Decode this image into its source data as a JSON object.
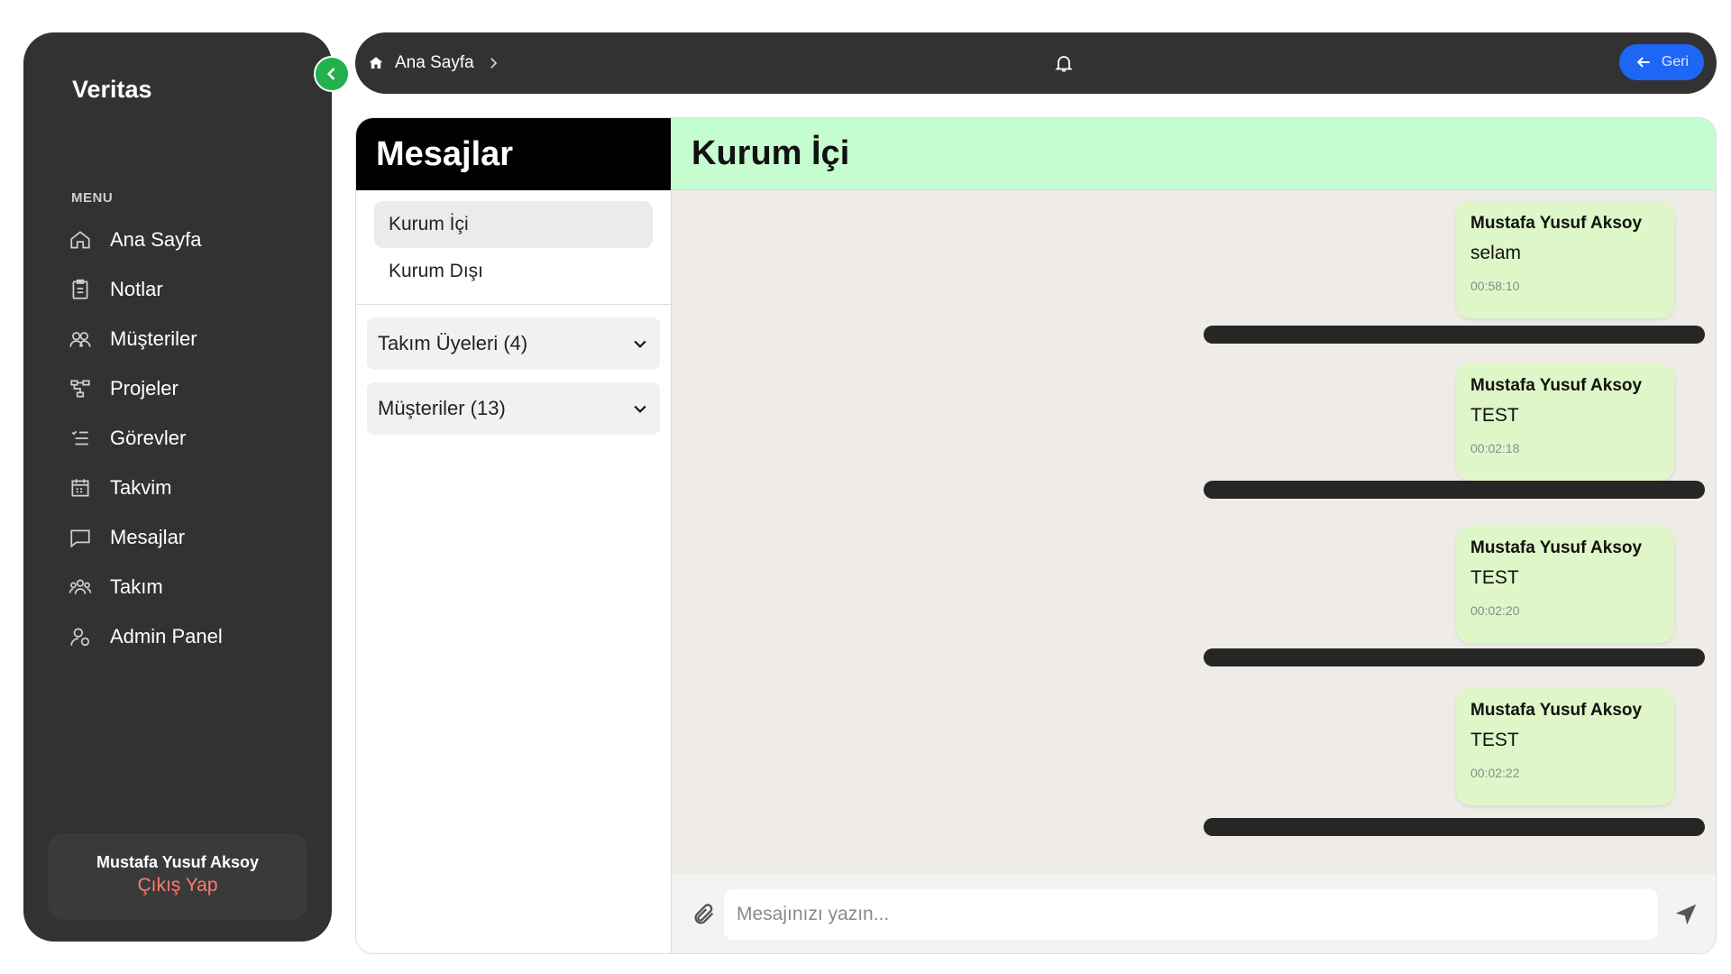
{
  "app": {
    "name": "Veritas"
  },
  "sidebar": {
    "menu_title": "MENU",
    "items": [
      {
        "label": "Ana Sayfa",
        "icon": "home-icon"
      },
      {
        "label": "Notlar",
        "icon": "clipboard-icon"
      },
      {
        "label": "Müşteriler",
        "icon": "users-icon"
      },
      {
        "label": "Projeler",
        "icon": "hierarchy-icon"
      },
      {
        "label": "Görevler",
        "icon": "list-icon"
      },
      {
        "label": "Takvim",
        "icon": "calendar-icon"
      },
      {
        "label": "Mesajlar",
        "icon": "chat-icon"
      },
      {
        "label": "Takım",
        "icon": "team-icon"
      },
      {
        "label": "Admin Panel",
        "icon": "admin-icon"
      }
    ],
    "user": {
      "name": "Mustafa Yusuf Aksoy",
      "logout_label": "Çıkış Yap"
    }
  },
  "topbar": {
    "breadcrumb": "Ana Sayfa",
    "back_label": "Geri"
  },
  "messages": {
    "title": "Mesajlar",
    "tabs": [
      {
        "label": "Kurum İçi",
        "active": true
      },
      {
        "label": "Kurum Dışı",
        "active": false
      }
    ],
    "groups": [
      {
        "label": "Takım Üyeleri (4)"
      },
      {
        "label": "Müşteriler (13)"
      }
    ]
  },
  "chat": {
    "title": "Kurum İçi",
    "messages": [
      {
        "sender": "Mustafa Yusuf Aksoy",
        "text": "selam",
        "time": "00:58:10"
      },
      {
        "sender": "Mustafa Yusuf Aksoy",
        "text": "TEST",
        "time": "00:02:18"
      },
      {
        "sender": "Mustafa Yusuf Aksoy",
        "text": "TEST",
        "time": "00:02:20"
      },
      {
        "sender": "Mustafa Yusuf Aksoy",
        "text": "TEST",
        "time": "00:02:22"
      }
    ],
    "input_placeholder": "Mesajınızı yazın..."
  },
  "colors": {
    "sidebar_bg": "#323232",
    "accent_green": "#22b14c",
    "back_button": "#1e66f5",
    "chat_header": "#c5fdd0",
    "bubble": "#dff7c8",
    "logout": "#ff7b72"
  }
}
